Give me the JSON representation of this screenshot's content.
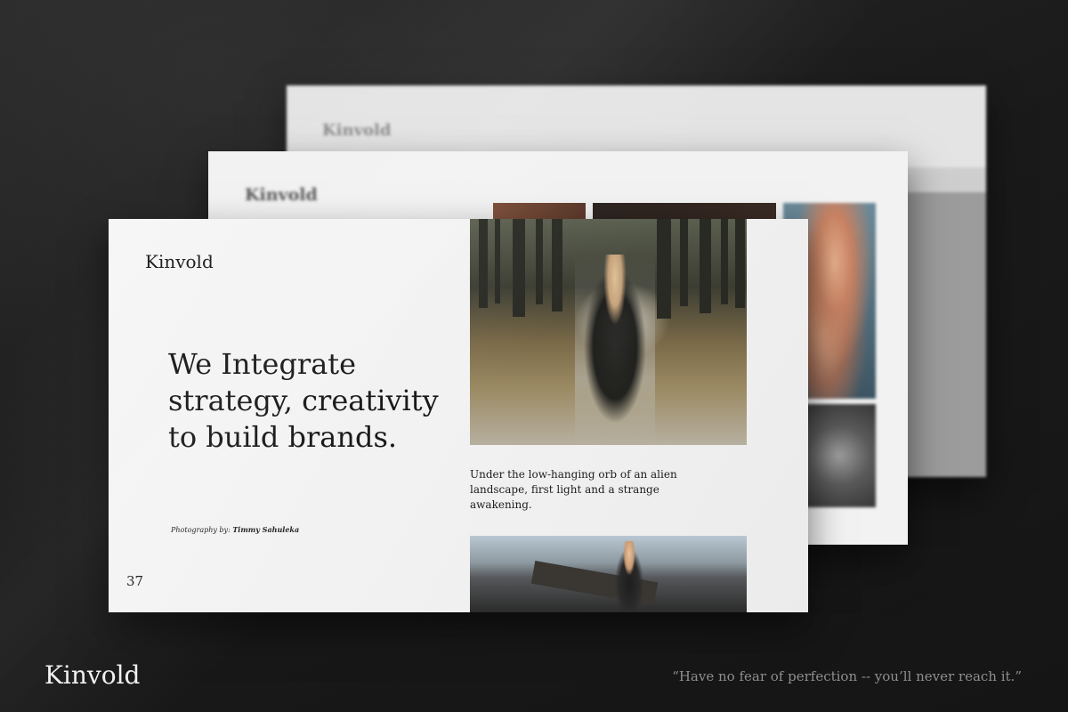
{
  "footer": {
    "brand": "Kinvold",
    "quote": "“Have no fear of perfection -- you’ll never reach it.”"
  },
  "back_slide": {
    "logo": "Kinvold"
  },
  "middle_slide": {
    "logo": "Kinvold"
  },
  "front_slide": {
    "logo": "Kinvold",
    "headline_lines": [
      "We Integrate",
      "strategy, creativity",
      "to build brands."
    ],
    "credit_prefix": "Photography by:",
    "credit_name": "Timmy Sahuleka",
    "page_number": "37",
    "caption_lines": [
      "Under the low-hanging orb of an alien",
      "landscape, first light and a strange",
      "awakening."
    ]
  }
}
